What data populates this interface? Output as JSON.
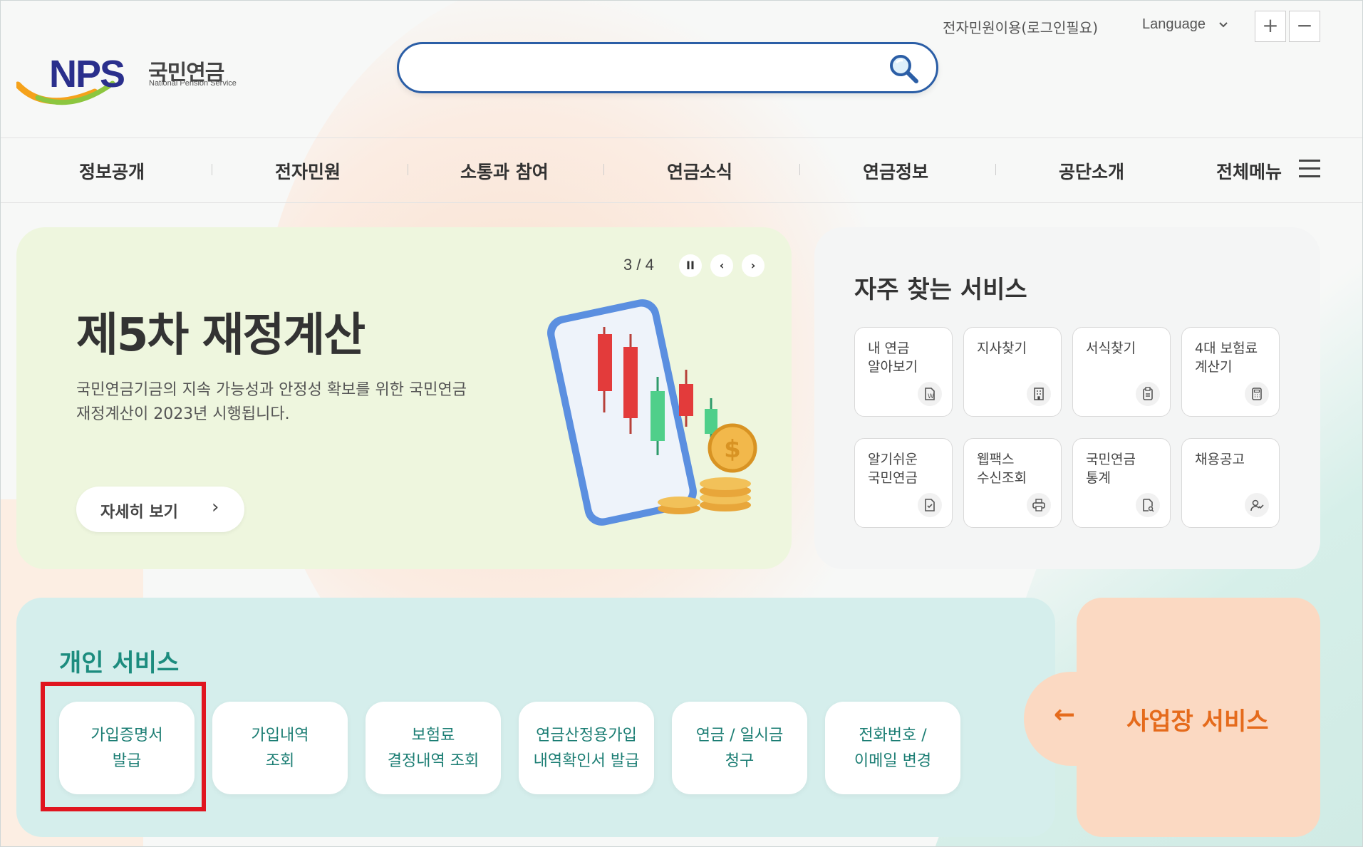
{
  "header": {
    "logo_text": "NPS",
    "logo_korean": "국민연금",
    "logo_english": "National Pension Service",
    "search_placeholder": "",
    "util_link": "전자민원이용(로그인필요)",
    "language": "Language",
    "zoom_in": "+",
    "zoom_out": "−"
  },
  "nav": {
    "items": [
      "정보공개",
      "전자민원",
      "소통과 참여",
      "연금소식",
      "연금정보",
      "공단소개"
    ],
    "all_menu": "전체메뉴"
  },
  "banner": {
    "title": "제5차 재정계산",
    "description": "국민연금기금의 지속 가능성과 안정성 확보를 위한 국민연금 재정계산이 2023년 시행됩니다.",
    "button": "자세히 보기",
    "pager": "3 / 4",
    "pause": "II",
    "prev": "‹",
    "next": "›"
  },
  "frequent": {
    "title": "자주 찾는 서비스",
    "items": [
      {
        "label": "내 연금\n알아보기",
        "icon": "pension-doc-icon"
      },
      {
        "label": "지사찾기",
        "icon": "building-icon"
      },
      {
        "label": "서식찾기",
        "icon": "clipboard-icon"
      },
      {
        "label": "4대 보험료\n계산기",
        "icon": "calculator-icon"
      },
      {
        "label": "알기쉬운\n국민연금",
        "icon": "document-check-icon"
      },
      {
        "label": "웹팩스\n수신조회",
        "icon": "printer-icon"
      },
      {
        "label": "국민연금\n통계",
        "icon": "document-search-icon"
      },
      {
        "label": "채용공고",
        "icon": "person-check-icon"
      }
    ]
  },
  "personal": {
    "title": "개인 서비스",
    "items": [
      "가입증명서\n발급",
      "가입내역\n조회",
      "보험료\n결정내역 조회",
      "연금산정용가입\n내역확인서 발급",
      "연금 / 일시금\n청구",
      "전화번호 /\n이메일 변경"
    ]
  },
  "business": {
    "arrow": "←",
    "label": "사업장 서비스"
  },
  "colors": {
    "brand_navy": "#2a2f8c",
    "search_border": "#2b5ea6",
    "personal_accent": "#1c8c7e",
    "business_accent": "#e56b1c",
    "highlight": "#e0151f"
  }
}
